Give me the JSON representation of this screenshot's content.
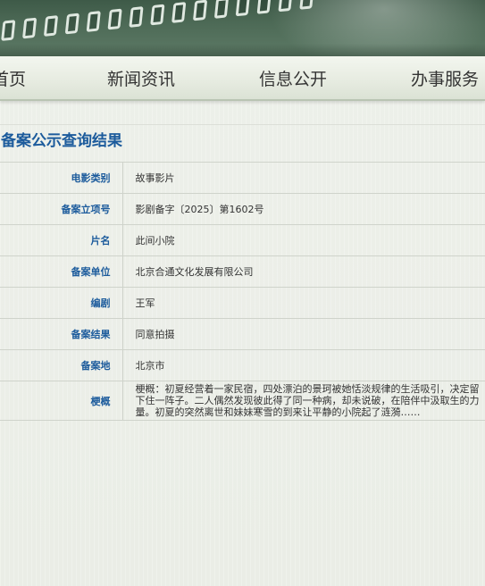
{
  "nav": {
    "items": [
      {
        "label": "首页"
      },
      {
        "label": "新闻资讯"
      },
      {
        "label": "信息公开"
      },
      {
        "label": "办事服务"
      }
    ]
  },
  "result": {
    "title": "备案公示查询结果",
    "rows": [
      {
        "label": "电影类别",
        "value": "故事影片"
      },
      {
        "label": "备案立项号",
        "value": "影剧备字〔2025〕第1602号"
      },
      {
        "label": "片名",
        "value": "此间小院"
      },
      {
        "label": "备案单位",
        "value": "北京合通文化发展有限公司"
      },
      {
        "label": "编剧",
        "value": "王军"
      },
      {
        "label": "备案结果",
        "value": "同意拍摄"
      },
      {
        "label": "备案地",
        "value": "北京市"
      },
      {
        "label": "梗概",
        "value": "梗概：初夏经营着一家民宿，四处漂泊的景珂被她恬淡规律的生活吸引，决定留下住一阵子。二人偶然发现彼此得了同一种病，却未说破，在陪伴中汲取生的力量。初夏的突然离世和妹妹寒雪的到来让平静的小院起了涟漪……"
      }
    ]
  }
}
